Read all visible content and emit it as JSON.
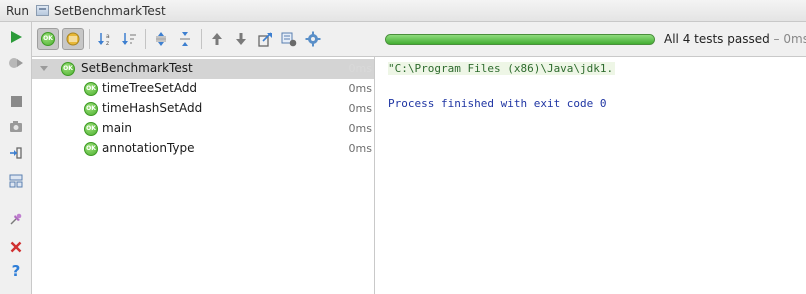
{
  "title_bar": {
    "run_label": "Run",
    "config_name": "SetBenchmarkTest"
  },
  "sidebar": {
    "buttons": [
      {
        "icon": "run-icon",
        "color": "#2c9b3a"
      },
      {
        "icon": "rerun-failed-icon",
        "color": "#9a9a9a"
      },
      {
        "icon": "stop-icon",
        "color": "#8a8a8a"
      },
      {
        "icon": "camera-icon",
        "color": "#8a8a8a"
      },
      {
        "icon": "import-icon",
        "color": "#5a7fb0"
      },
      {
        "icon": "layout-icon",
        "color": "#5a7fb0"
      },
      {
        "icon": "pin-icon",
        "color": "#a05ab0"
      },
      {
        "icon": "close-icon",
        "color": "#d03030"
      },
      {
        "icon": "help-icon",
        "color": "#2f7ed8"
      }
    ]
  },
  "toolbar": {
    "buttons": [
      {
        "icon": "show-passed-icon",
        "toggled": true
      },
      {
        "icon": "show-ignored-icon",
        "toggled": true
      },
      {
        "icon": "sort-alpha-icon",
        "toggled": false
      },
      {
        "icon": "sort-duration-icon",
        "toggled": false
      },
      {
        "icon": "expand-all-icon",
        "toggled": false
      },
      {
        "icon": "collapse-all-icon",
        "toggled": false
      },
      {
        "icon": "prev-test-icon",
        "toggled": false
      },
      {
        "icon": "next-test-icon",
        "toggled": false
      },
      {
        "icon": "export-icon",
        "toggled": false
      },
      {
        "icon": "import-tests-icon",
        "toggled": false
      },
      {
        "icon": "settings-icon",
        "toggled": false
      }
    ],
    "progress_fraction": 1.0,
    "progress_color": "#3ea52e",
    "status_text": "All 4 tests passed",
    "status_duration": " – 0ms"
  },
  "test_tree": {
    "badge_text": "OK",
    "root": {
      "label": "SetBenchmarkTest",
      "time": "0ms",
      "selected": true
    },
    "children": [
      {
        "label": "timeTreeSetAdd",
        "time": "0ms"
      },
      {
        "label": "timeHashSetAdd",
        "time": "0ms"
      },
      {
        "label": "main",
        "time": "0ms"
      },
      {
        "label": "annotationType",
        "time": "0ms"
      }
    ]
  },
  "console": {
    "command_line": "\"C:\\Program Files (x86)\\Java\\jdk1.",
    "exit_line": "Process finished with exit code 0"
  }
}
